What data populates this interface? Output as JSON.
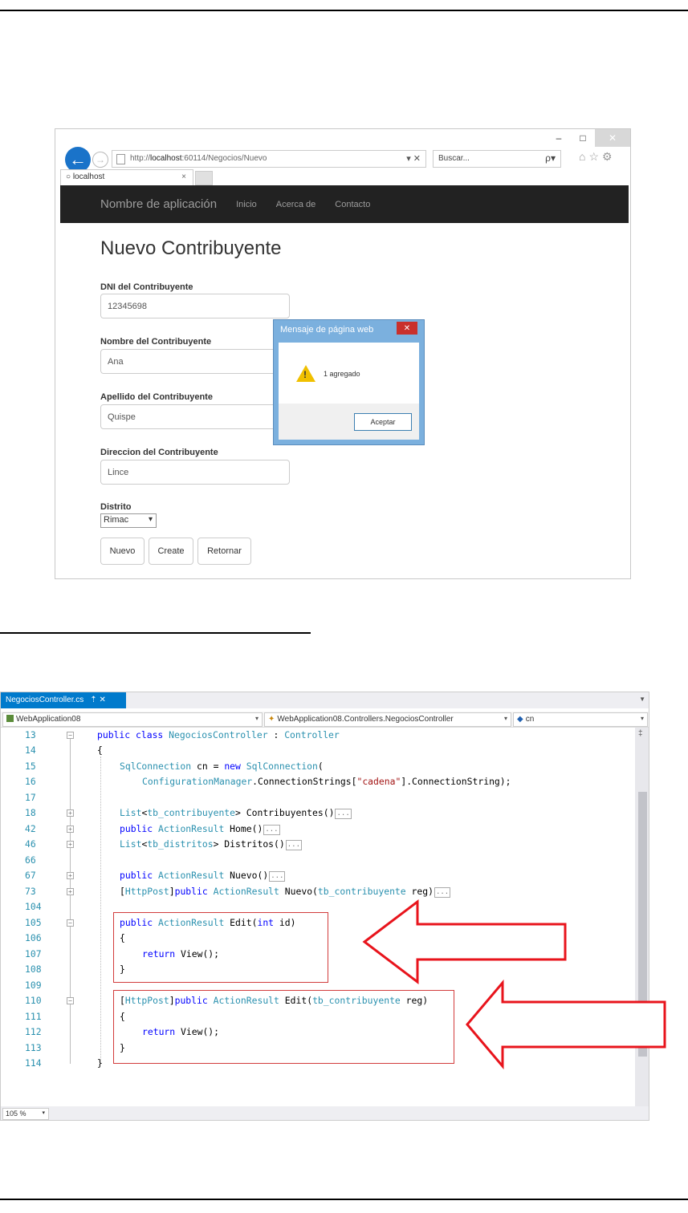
{
  "browser": {
    "url_prefix": "http://",
    "url_host": "localhost",
    "url_rest": ":60114/Negocios/Nuevo",
    "url_actions": "▾ ✕",
    "search_placeholder": "Buscar...",
    "search_icon": "ρ▾",
    "tab_label": "localhost",
    "tab_close": "×",
    "window_minimize": "–",
    "window_maximize": "□",
    "window_close": "✕",
    "back_icon": "arrow-left-icon",
    "forward_icon": "arrow-right-icon",
    "toolbar_icons": "⌂☆⚙"
  },
  "navbar": {
    "brand": "Nombre de aplicación",
    "links": [
      "Inicio",
      "Acerca de",
      "Contacto"
    ]
  },
  "form": {
    "title": "Nuevo Contribuyente",
    "dni_label": "DNI del Contribuyente",
    "dni_value": "12345698",
    "nombre_label": "Nombre del Contribuyente",
    "nombre_value": "Ana",
    "apellido_label": "Apellido del Contribuyente",
    "apellido_value": "Quispe",
    "direccion_label": "Direccion del Contribuyente",
    "direccion_value": "Lince",
    "distrito_label": "Distrito",
    "distrito_value": "Rimac",
    "buttons": [
      "Nuevo",
      "Create",
      "Retornar"
    ]
  },
  "dialog": {
    "title": "Mensaje de página web",
    "message": "1 agregado",
    "ok_label": "Aceptar",
    "warning_glyph": "!",
    "close_glyph": "✕"
  },
  "editor": {
    "tab_label": "NegociosController.cs",
    "tab_pin": "⇡",
    "tab_close": "✕",
    "project": "WebApplication08",
    "type_nav": "WebApplication08.Controllers.NegociosController",
    "member_nav": "cn",
    "zoom": "105 %",
    "line_numbers": [
      "13",
      "14",
      "15",
      "16",
      "17",
      "18",
      "42",
      "46",
      "66",
      "67",
      "73",
      "104",
      "105",
      "106",
      "107",
      "108",
      "109",
      "110",
      "111",
      "112",
      "113",
      "114"
    ],
    "code": {
      "l13_kw": "public class ",
      "l13_cls": "NegociosController",
      "l13_sep": " : ",
      "l13_base": "Controller",
      "l14": "{",
      "l15_ty": "SqlConnection",
      "l15_mid": " cn = ",
      "l15_kw": "new ",
      "l15_ty2": "SqlConnection",
      "l15_end": "(",
      "l16_ty": "ConfigurationManager",
      "l16_mid": ".ConnectionStrings[",
      "l16_str": "\"cadena\"",
      "l16_end": "].ConnectionString);",
      "l18_ty": "List",
      "l18_lt": "<",
      "l18_ty2": "tb_contribuyente",
      "l18_end": "> Contribuyentes()",
      "l42_kw": "public ",
      "l42_ty": "ActionResult",
      "l42_end": " Home()",
      "l46_ty": "List",
      "l46_lt": "<",
      "l46_ty2": "tb_distritos",
      "l46_end": "> Distritos()",
      "l67_kw": "public ",
      "l67_ty": "ActionResult",
      "l67_end": " Nuevo()",
      "l73_open": "[",
      "l73_attr": "HttpPost",
      "l73_close": "]",
      "l73_kw": "public ",
      "l73_ty": "ActionResult",
      "l73_mid": " Nuevo(",
      "l73_ty2": "tb_contribuyente",
      "l73_end": " reg)",
      "l105_kw": "public ",
      "l105_ty": "ActionResult",
      "l105_mid": " Edit(",
      "l105_kw2": "int",
      "l105_end": " id)",
      "l106": "{",
      "l107_kw": "return ",
      "l107_end": "View();",
      "l108": "}",
      "l110_open": "[",
      "l110_attr": "HttpPost",
      "l110_close": "]",
      "l110_kw": "public ",
      "l110_ty": "ActionResult",
      "l110_mid": " Edit(",
      "l110_ty2": "tb_contribuyente",
      "l110_end": " reg)",
      "l111": "{",
      "l112_kw": "return ",
      "l112_end": "View();",
      "l113": "}",
      "l114": "}",
      "collapsed": "..."
    }
  },
  "colors": {
    "keyword": "#0000ff",
    "type": "#2b91af",
    "string": "#a31515",
    "highlight_box": "#d23c3c",
    "arrow": "#e8141c",
    "vs_tab": "#007acc",
    "navbar": "#222222"
  }
}
